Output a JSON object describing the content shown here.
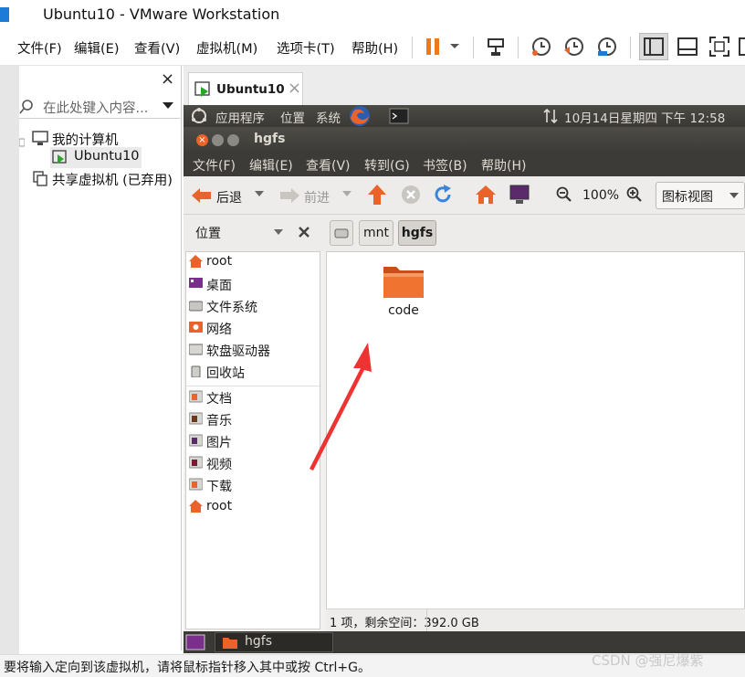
{
  "window": {
    "title": "Ubuntu10 - VMware Workstation"
  },
  "menubar": {
    "items": [
      "文件(F)",
      "编辑(E)",
      "查看(V)",
      "虚拟机(M)",
      "选项卡(T)",
      "帮助(H)"
    ]
  },
  "library": {
    "close_label": "×",
    "search_placeholder": "在此处键入内容...",
    "tree": {
      "my_computer": "我的计算机",
      "vm_name": "Ubuntu10",
      "shared": "共享虚拟机 (已弃用)"
    }
  },
  "tabs": [
    {
      "label": "Ubuntu10",
      "close": "×"
    }
  ],
  "guest": {
    "top_panel": {
      "applications": "应用程序",
      "places": "位置",
      "system": "系统",
      "datetime": "10月14日星期四 下午 12:58"
    },
    "nautilus": {
      "title": "hgfs",
      "menu": [
        "文件(F)",
        "编辑(E)",
        "查看(V)",
        "转到(G)",
        "书签(B)",
        "帮助(H)"
      ],
      "toolbar": {
        "back": "后退",
        "forward": "前进",
        "zoom": "100%",
        "view_mode": "图标视图"
      },
      "places_label": "位置",
      "path": [
        "mnt",
        "hgfs"
      ],
      "places_items": [
        "root",
        "桌面",
        "文件系统",
        "网络",
        "软盘驱动器",
        "回收站"
      ],
      "bookmarks": [
        "文档",
        "音乐",
        "图片",
        "视频",
        "下载",
        "root"
      ],
      "files": [
        {
          "name": "code",
          "icon": "folder-icon"
        }
      ],
      "status": "1 项，剩余空间：392.0 GB"
    },
    "taskbar": {
      "window_item": "hgfs"
    }
  },
  "statusbar": {
    "text": "要将输入定向到该虚拟机，请将鼠标指针移入其中或按 Ctrl+G。"
  },
  "watermark": "CSDN @强尼爆紫",
  "colors": {
    "ubuntu_orange": "#e9632b",
    "ubuntu_dark": "#3c3b37",
    "annotation_red": "#ee3333"
  }
}
